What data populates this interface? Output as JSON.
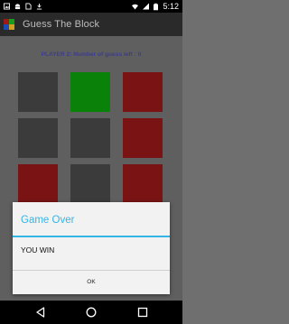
{
  "status_bar": {
    "time": "5:12"
  },
  "app_bar": {
    "title": "Guess The Block"
  },
  "game": {
    "guess_text": "PLAYER 2: Number of guess left : 0",
    "grid_colors": [
      "#3b3b3b",
      "#0a820a",
      "#7a1414",
      "#3b3b3b",
      "#3b3b3b",
      "#7a1414",
      "#7a1414",
      "#3b3b3b",
      "#7a1414"
    ]
  },
  "dialog": {
    "title": "Game Over",
    "message": "YOU WIN",
    "ok_label": "OK"
  },
  "colors": {
    "accent": "#33b5e5",
    "label": "#3c3d8f"
  }
}
